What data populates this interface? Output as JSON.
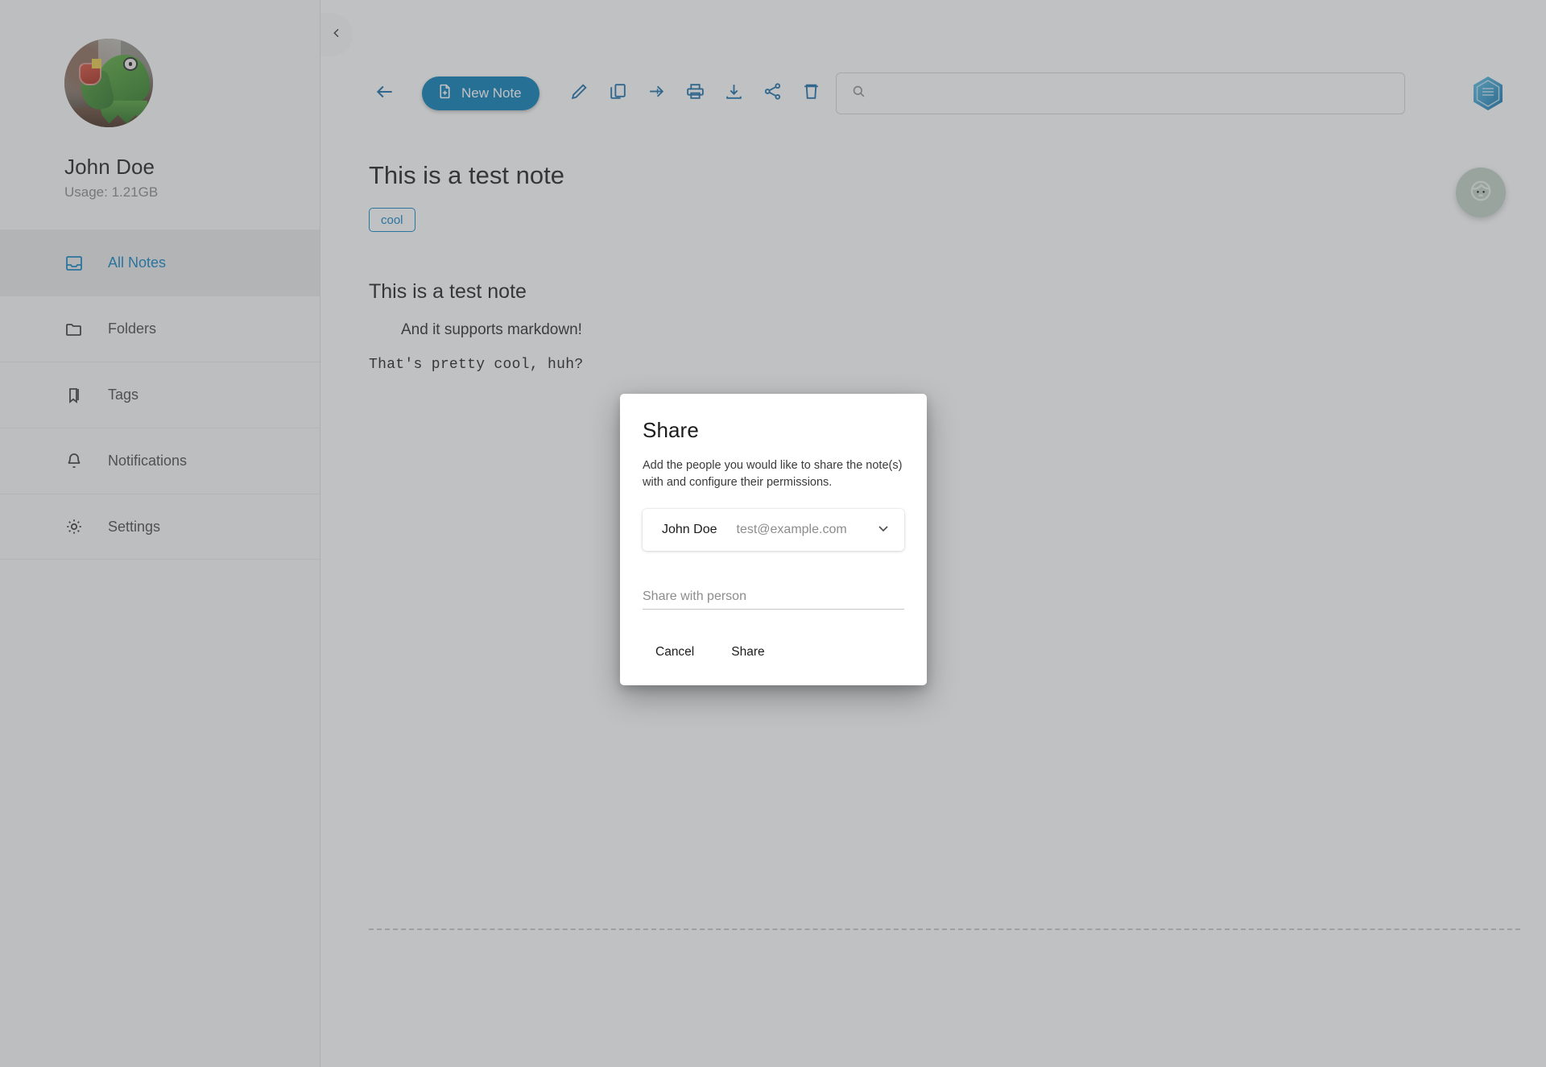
{
  "sidebar": {
    "profile": {
      "name": "John Doe",
      "usage": "Usage: 1.21GB",
      "avatar_icon": "kermit-avatar"
    },
    "collapse_icon": "chevron-left-icon",
    "items": [
      {
        "label": "All Notes",
        "icon": "inbox-icon",
        "active": true
      },
      {
        "label": "Folders",
        "icon": "folder-icon",
        "active": false
      },
      {
        "label": "Tags",
        "icon": "bookmark-icon",
        "active": false
      },
      {
        "label": "Notifications",
        "icon": "bell-icon",
        "active": false
      },
      {
        "label": "Settings",
        "icon": "gear-icon",
        "active": false
      }
    ]
  },
  "toolbar": {
    "back_icon": "arrow-left-icon",
    "new_note_label": "New Note",
    "new_note_icon": "file-plus-icon",
    "actions": [
      {
        "name": "edit",
        "icon": "pencil-icon"
      },
      {
        "name": "copy",
        "icon": "copy-icon"
      },
      {
        "name": "move",
        "icon": "arrow-right-icon"
      },
      {
        "name": "print",
        "icon": "printer-icon"
      },
      {
        "name": "download",
        "icon": "download-icon"
      },
      {
        "name": "share",
        "icon": "share-icon"
      },
      {
        "name": "delete",
        "icon": "trash-icon"
      }
    ]
  },
  "search": {
    "value": "",
    "placeholder": "",
    "icon": "search-icon"
  },
  "brand": {
    "icon": "hexagon-logo-icon"
  },
  "fab": {
    "icon": "face-icon"
  },
  "note": {
    "title": "This is a test note",
    "tags": [
      "cool"
    ],
    "body": {
      "heading": "This is a test note",
      "quote": "And it supports markdown!",
      "code": "That's pretty cool, huh?"
    }
  },
  "share_modal": {
    "title": "Share",
    "description": "Add the people you would like to share the note(s) with and configure their permissions.",
    "person": {
      "name": "John Doe",
      "email": "test@example.com",
      "chevron_icon": "chevron-down-icon"
    },
    "share_input": {
      "value": "",
      "placeholder": "Share with person"
    },
    "cancel_label": "Cancel",
    "share_label": "Share"
  },
  "colors": {
    "accent": "#1184c4",
    "primary_button": "#0b7cb5",
    "overlay": "#a8abae",
    "sidebar_bg": "#fafafa"
  }
}
